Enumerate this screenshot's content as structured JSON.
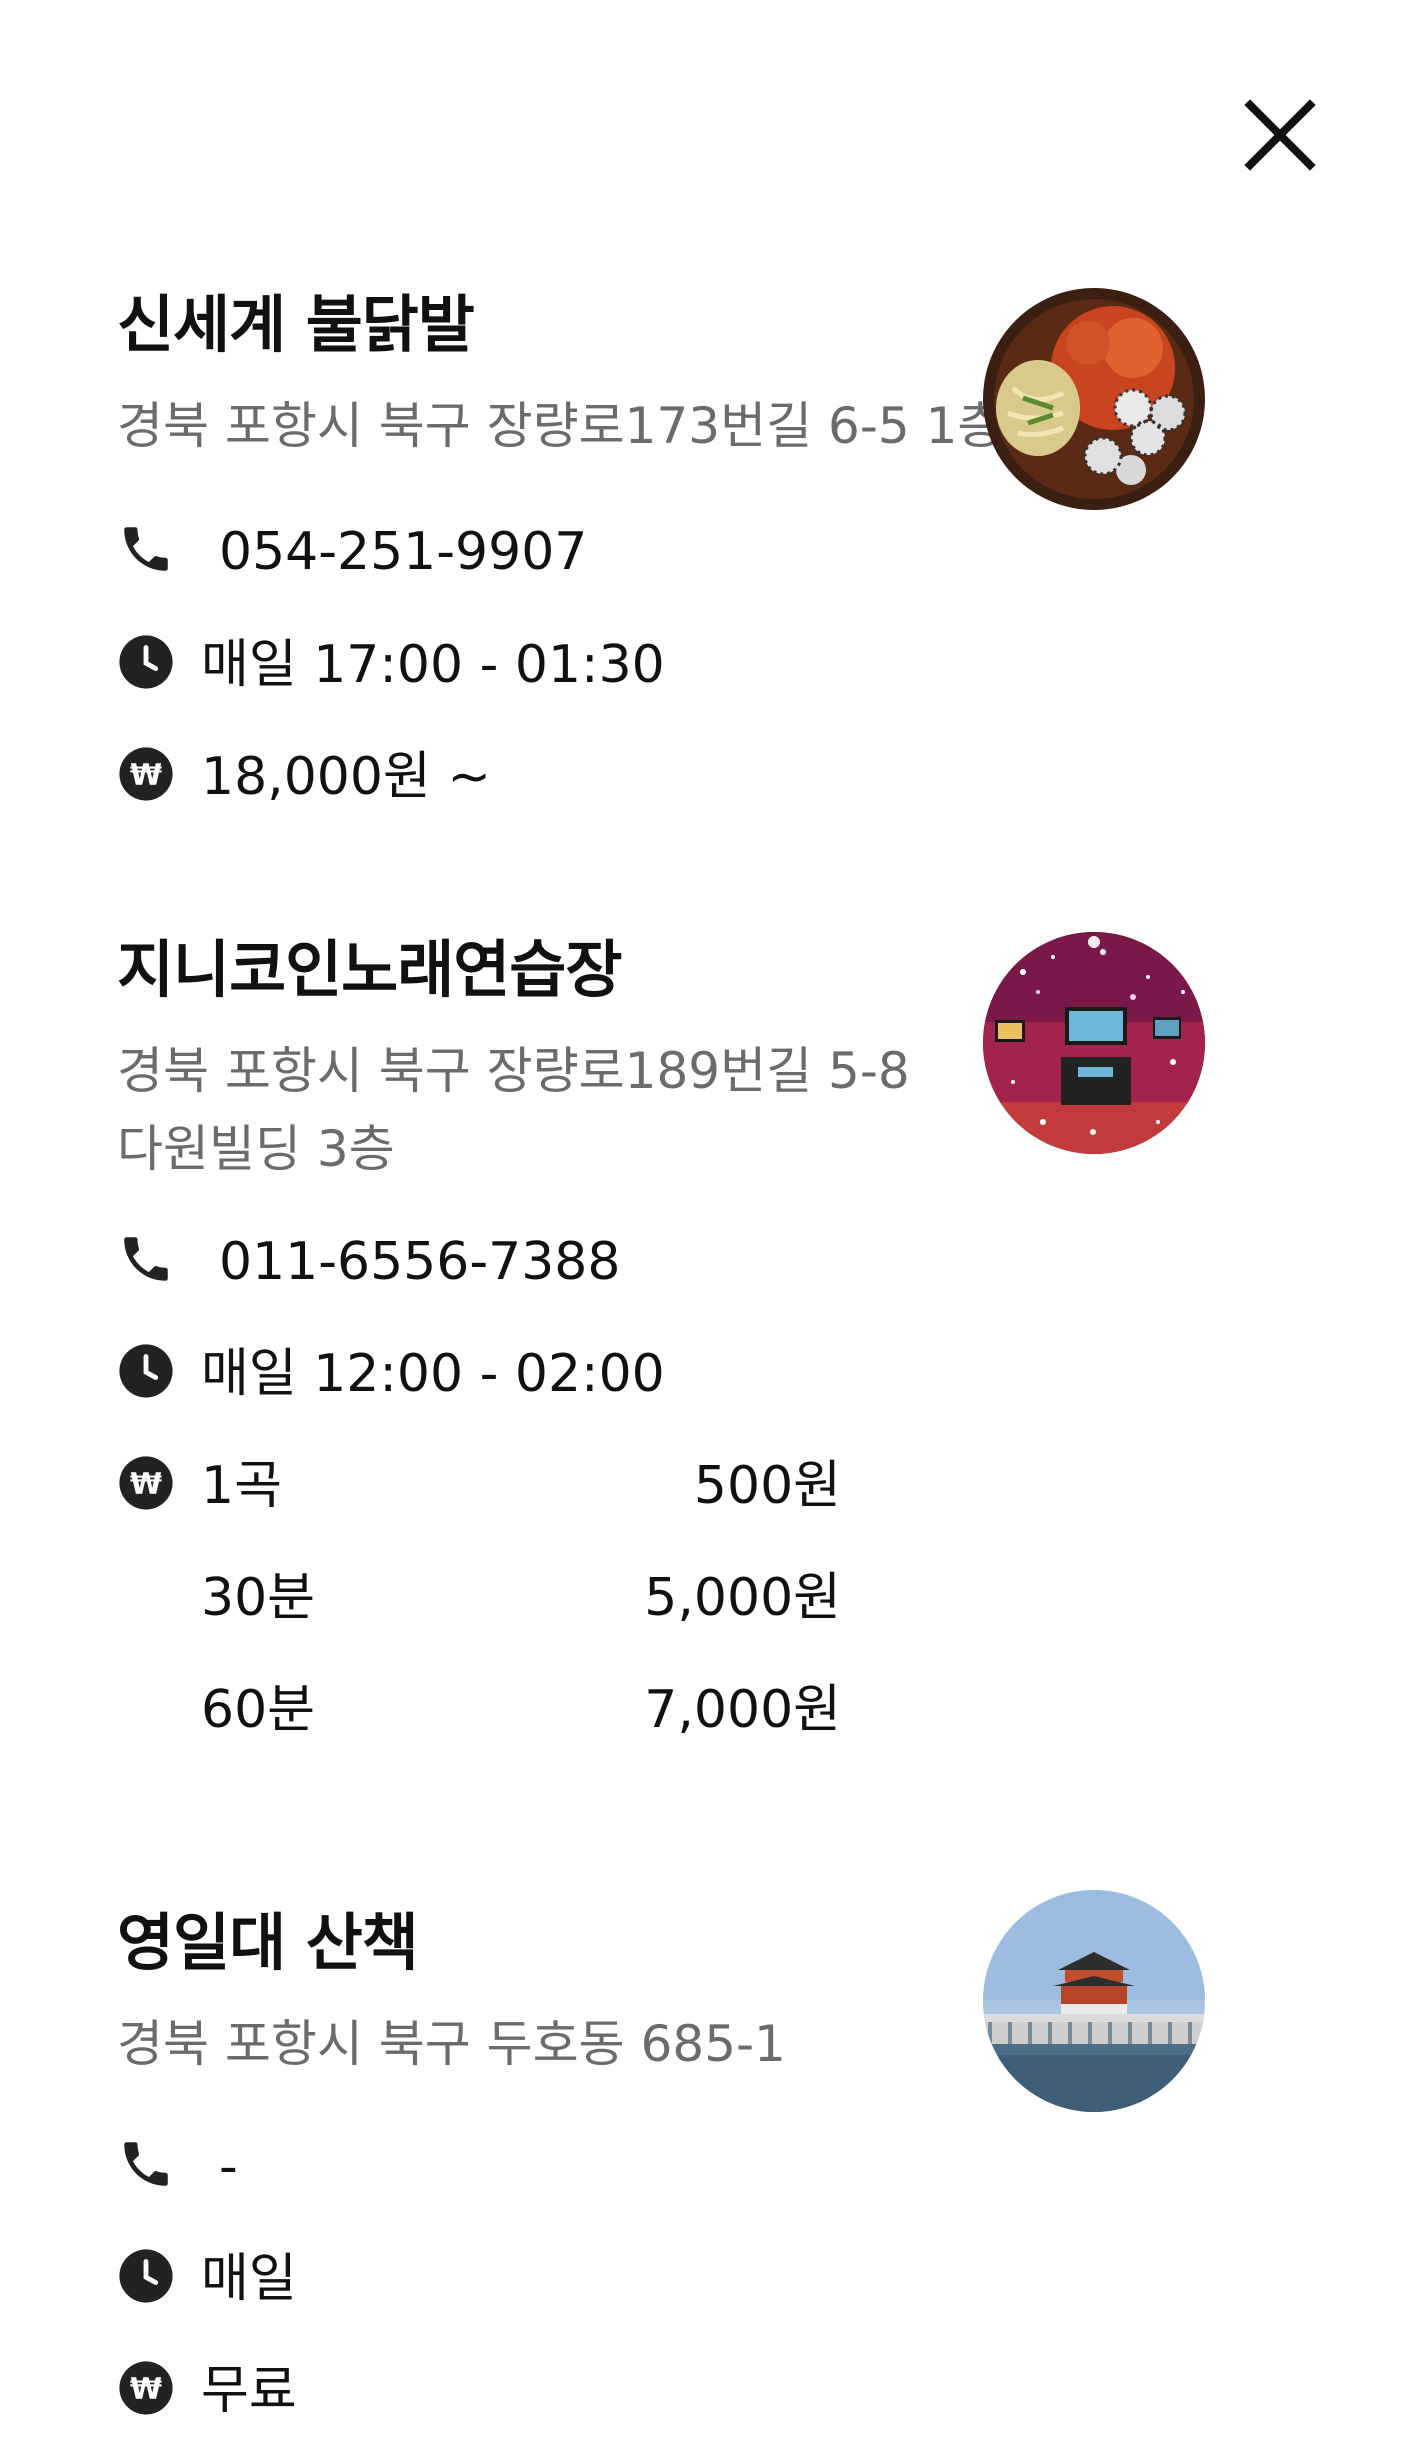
{
  "close_icon": "close-icon",
  "places": [
    {
      "title": "신세계 불닭발",
      "address": "경북 포항시 북구 장량로173번길 6-5 1층",
      "phone": "054-251-9907",
      "hours": "매일 17:00 - 01:30",
      "price": "18,000원 ~",
      "image": "spicy-chicken-feet-dish"
    },
    {
      "title": "지니코인노래연습장",
      "address_line1": "경북 포항시 북구 장량로189번길 5-8",
      "address_line2": "다원빌딩 3층",
      "phone": "011-6556-7388",
      "hours": "매일 12:00 - 02:00",
      "prices": [
        {
          "label": "1곡",
          "value": "500원"
        },
        {
          "label": "30분",
          "value": "5,000원"
        },
        {
          "label": "60분",
          "value": "7,000원"
        }
      ],
      "image": "karaoke-room"
    },
    {
      "title": "영일대 산책",
      "address": "경북 포항시 북구 두호동 685-1",
      "phone": "-",
      "hours": "매일",
      "price": "무료",
      "image": "yeongildae-pavilion"
    }
  ],
  "colors": {
    "title": "#111111",
    "address": "#6b6b6b",
    "icon": "#222222"
  }
}
